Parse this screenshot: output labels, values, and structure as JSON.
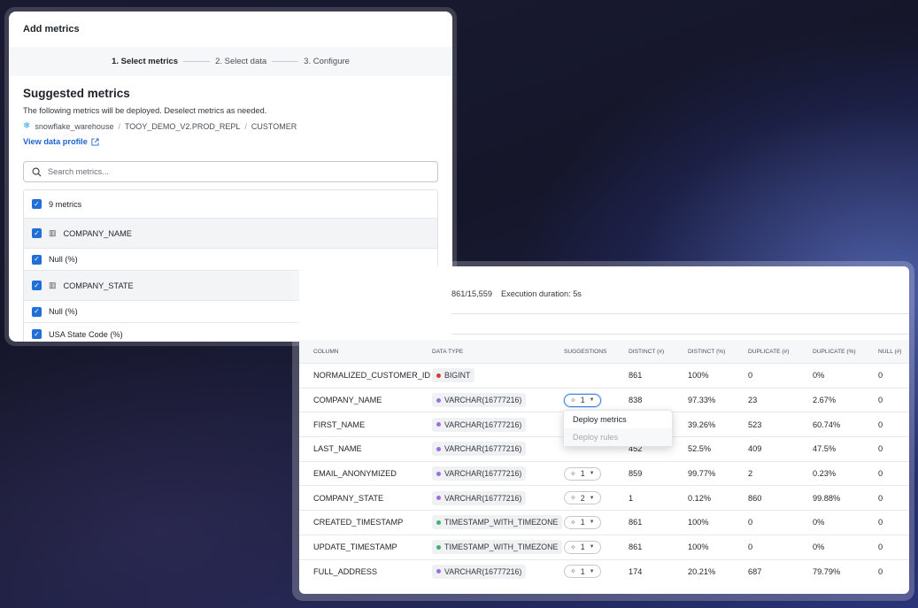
{
  "modal": {
    "title": "Add metrics",
    "steps": [
      "1. Select metrics",
      "2. Select data",
      "3. Configure"
    ],
    "heading": "Suggested metrics",
    "description": "The following metrics will be deployed. Deselect metrics as needed.",
    "breadcrumb": [
      "snowflake_warehouse",
      "TOOY_DEMO_V2.PROD_REPL",
      "CUSTOMER"
    ],
    "profile_link": "View data profile",
    "search_placeholder": "Search metrics...",
    "metric_count": "9 metrics",
    "rows": [
      {
        "kind": "column",
        "label": "COMPANY_NAME"
      },
      {
        "kind": "metric",
        "label": "Null (%)"
      },
      {
        "kind": "column",
        "label": "COMPANY_STATE"
      },
      {
        "kind": "metric",
        "label": "Null (%)"
      },
      {
        "kind": "metric",
        "label": "USA State Code (%)"
      }
    ]
  },
  "profile": {
    "rows_text": "861/15,559",
    "exec_text": "Execution duration: 5s",
    "headers": [
      "COLUMN",
      "DATA TYPE",
      "SUGGESTIONS",
      "DISTINCT (#)",
      "DISTINCT (%)",
      "DUPLICATE (#)",
      "DUPLICATE (%)",
      "NULL (#)"
    ],
    "type_colors": {
      "BIGINT": "#d93a3a",
      "VARCHAR(16777216)": "#9b6fe0",
      "TIMESTAMP_WITH_TIMEZONE": "#3cb371"
    },
    "rows": [
      {
        "column": "NORMALIZED_CUSTOMER_ID",
        "type": "BIGINT",
        "sugg": "",
        "distinct": "861",
        "distinct_pct": "100%",
        "dup": "0",
        "dup_pct": "0%",
        "nulls": "0"
      },
      {
        "column": "COMPANY_NAME",
        "type": "VARCHAR(16777216)",
        "sugg": "1",
        "distinct": "838",
        "distinct_pct": "97.33%",
        "dup": "23",
        "dup_pct": "2.67%",
        "nulls": "0"
      },
      {
        "column": "FIRST_NAME",
        "type": "VARCHAR(16777216)",
        "sugg": "",
        "distinct": "",
        "distinct_pct": "39.26%",
        "dup": "523",
        "dup_pct": "60.74%",
        "nulls": "0"
      },
      {
        "column": "LAST_NAME",
        "type": "VARCHAR(16777216)",
        "sugg": "",
        "distinct": "452",
        "distinct_pct": "52.5%",
        "dup": "409",
        "dup_pct": "47.5%",
        "nulls": "0"
      },
      {
        "column": "EMAIL_ANONYMIZED",
        "type": "VARCHAR(16777216)",
        "sugg": "1",
        "distinct": "859",
        "distinct_pct": "99.77%",
        "dup": "2",
        "dup_pct": "0.23%",
        "nulls": "0"
      },
      {
        "column": "COMPANY_STATE",
        "type": "VARCHAR(16777216)",
        "sugg": "2",
        "distinct": "1",
        "distinct_pct": "0.12%",
        "dup": "860",
        "dup_pct": "99.88%",
        "nulls": "0"
      },
      {
        "column": "CREATED_TIMESTAMP",
        "type": "TIMESTAMP_WITH_TIMEZONE",
        "sugg": "1",
        "distinct": "861",
        "distinct_pct": "100%",
        "dup": "0",
        "dup_pct": "0%",
        "nulls": "0"
      },
      {
        "column": "UPDATE_TIMESTAMP",
        "type": "TIMESTAMP_WITH_TIMEZONE",
        "sugg": "1",
        "distinct": "861",
        "distinct_pct": "100%",
        "dup": "0",
        "dup_pct": "0%",
        "nulls": "0"
      },
      {
        "column": "FULL_ADDRESS",
        "type": "VARCHAR(16777216)",
        "sugg": "1",
        "distinct": "174",
        "distinct_pct": "20.21%",
        "dup": "687",
        "dup_pct": "79.79%",
        "nulls": "0"
      }
    ],
    "dropdown": [
      "Deploy metrics",
      "Deploy rules"
    ]
  }
}
